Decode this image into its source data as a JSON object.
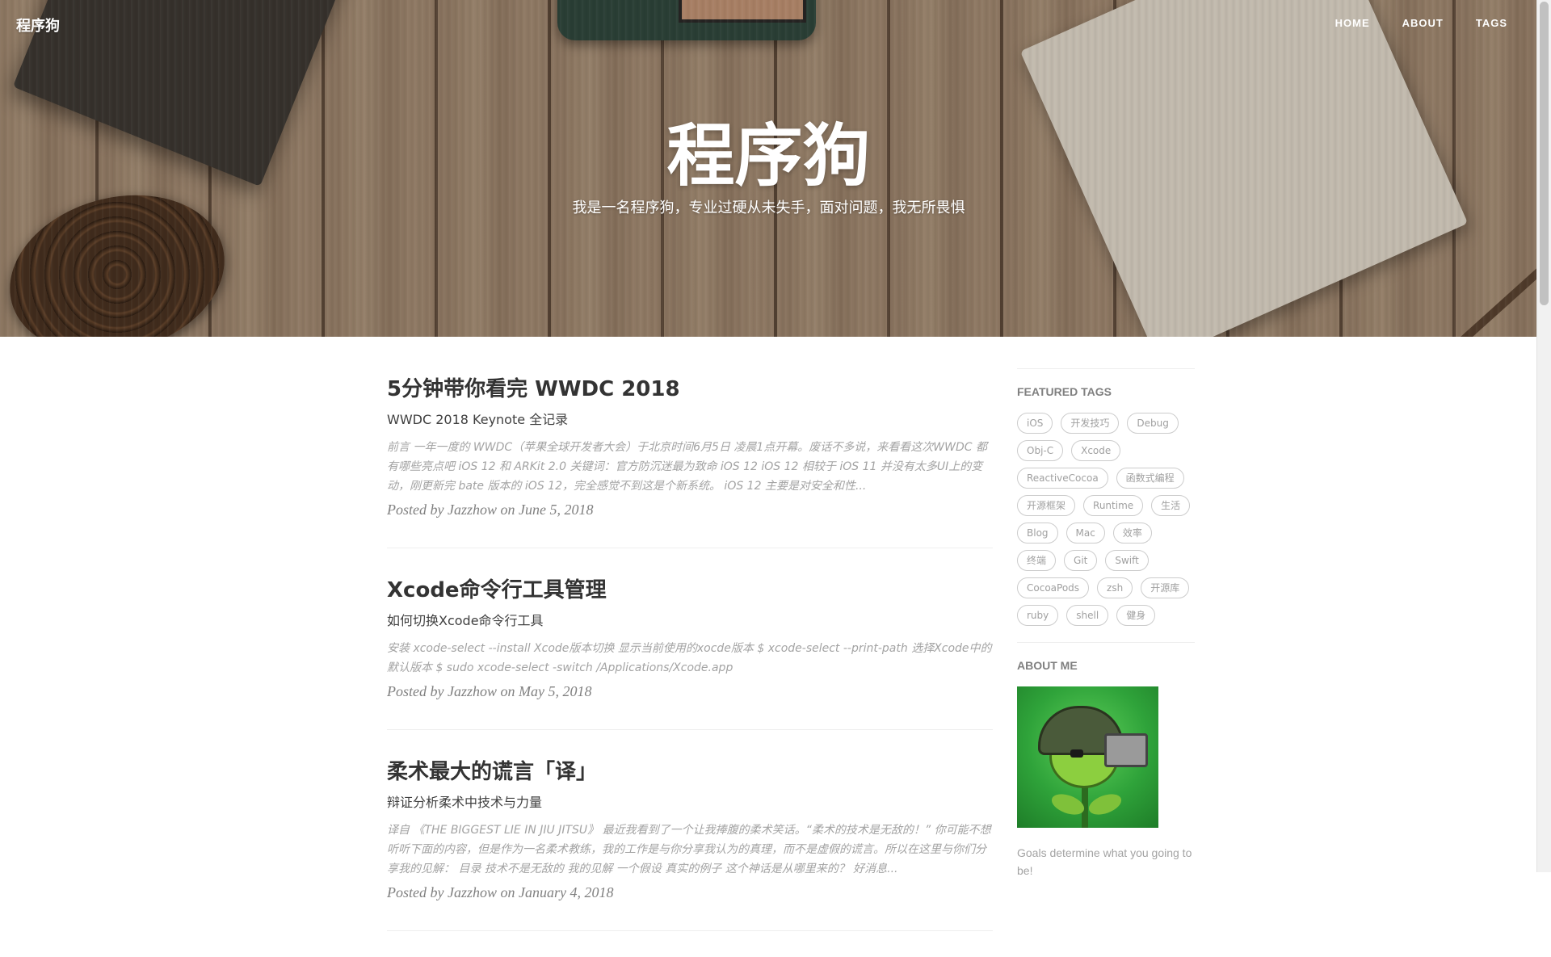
{
  "header": {
    "brand": "程序狗",
    "nav": [
      "HOME",
      "ABOUT",
      "TAGS"
    ],
    "title": "程序狗",
    "subtitle": "我是一名程序狗，专业过硬从未失手，面对问题，我无所畏惧"
  },
  "posts": [
    {
      "title": "5分钟带你看完 WWDC 2018",
      "subtitle": "WWDC 2018 Keynote 全记录",
      "excerpt": "前言 一年一度的 WWDC（苹果全球开发者大会）于北京时间6月5日 凌晨1点开幕。废话不多说，来看看这次WWDC 都有哪些亮点吧 iOS 12 和 ARKit 2.0 关键词：官方防沉迷最为致命 iOS 12 iOS 12 相较于 iOS 11 并没有太多UI上的变动，刚更新完 bate 版本的 iOS 12，完全感觉不到这是个新系统。 iOS 12 主要是对安全和性...",
      "meta": "Posted by Jazzhow on June 5, 2018"
    },
    {
      "title": "Xcode命令行工具管理",
      "subtitle": "如何切换Xcode命令行工具",
      "excerpt": "安装 xcode-select --install Xcode版本切换 显示当前使用的xocde版本 $ xcode-select --print-path 选择Xcode中的默认版本 $ sudo xcode-select -switch /Applications/Xcode.app",
      "meta": "Posted by Jazzhow on May 5, 2018"
    },
    {
      "title": "柔术最大的谎言「译」",
      "subtitle": "辩证分析柔术中技术与力量",
      "excerpt": "译自 《THE BIGGEST LIE IN JIU JITSU》 最近我看到了一个让我捧腹的柔术笑话。“柔术的技术是无敌的！” 你可能不想听听下面的内容，但是作为一名柔术教练，我的工作是与你分享我认为的真理，而不是虚假的谎言。所以在这里与你们分享我的见解： 目录 技术不是无敌的 我的见解 一个假设 真实的例子 这个神话是从哪里来的？ 好消息...",
      "meta": "Posted by Jazzhow on January 4, 2018"
    }
  ],
  "sidebar": {
    "featured_tags_heading": "FEATURED TAGS",
    "tags": [
      "iOS",
      "开发技巧",
      "Debug",
      "Obj-C",
      "Xcode",
      "ReactiveCocoa",
      "函数式编程",
      "开源框架",
      "Runtime",
      "生活",
      "Blog",
      "Mac",
      "效率",
      "终端",
      "Git",
      "Swift",
      "CocoaPods",
      "zsh",
      "开源库",
      "ruby",
      "shell",
      "健身"
    ],
    "about_heading": "ABOUT ME",
    "about_text": "Goals determine what you going to be!"
  }
}
